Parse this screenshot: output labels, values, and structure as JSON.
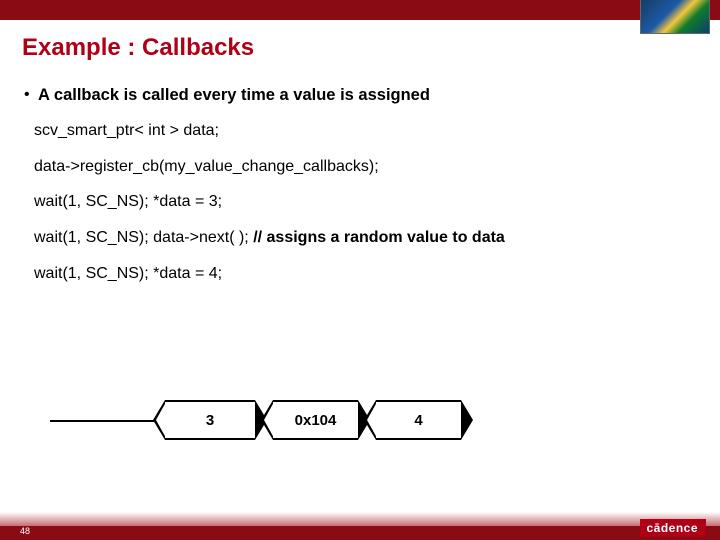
{
  "title": "Example : Callbacks",
  "bullet": "A callback is called every time a value is assigned",
  "code": {
    "l1": "scv_smart_ptr< int > data;",
    "l2": "data->register_cb(my_value_change_callbacks);",
    "l3a": "wait(1, SC_NS); *data = 3;",
    "l4a": "wait(1, SC_NS); data->next( ); ",
    "l4b": "// assigns a random value to data",
    "l5a": "wait(1, SC_NS); *data = 4;"
  },
  "wave": {
    "v1": "3",
    "v2": "0x104",
    "v3": "4"
  },
  "footer": {
    "page": "48",
    "brand": "cādence"
  }
}
